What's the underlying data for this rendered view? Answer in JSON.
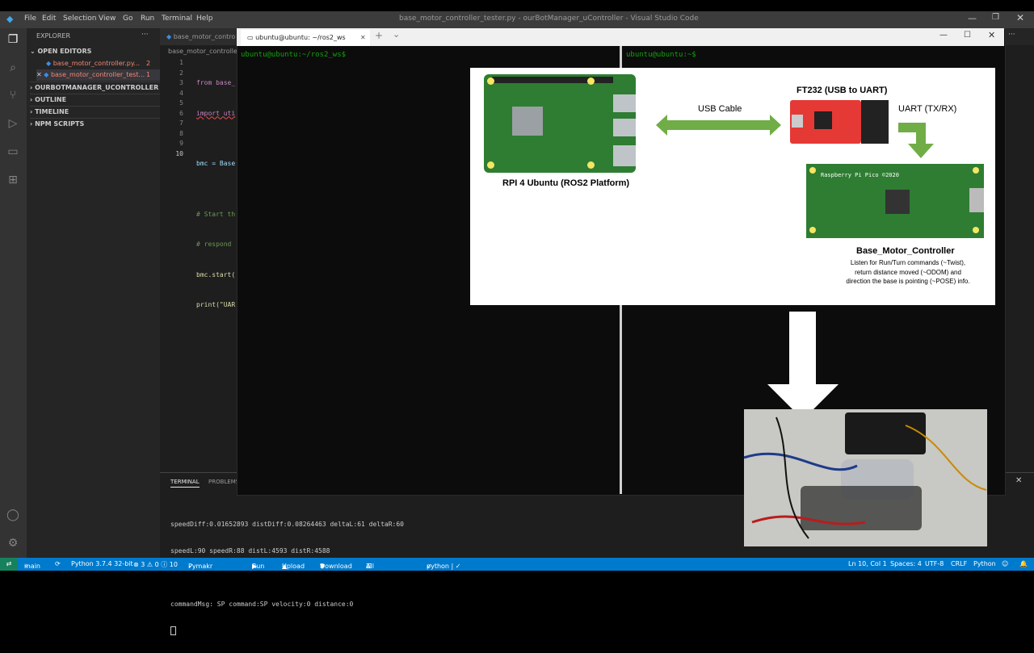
{
  "window": {
    "title": "base_motor_controller_tester.py - ourBotManager_uController - Visual Studio Code"
  },
  "menu": [
    "File",
    "Edit",
    "Selection",
    "View",
    "Go",
    "Run",
    "Terminal",
    "Help"
  ],
  "explorer": {
    "header": "EXPLORER",
    "open_editors": "OPEN EDITORS",
    "files": [
      {
        "name": "base_motor_controller.py...",
        "badge": "2"
      },
      {
        "name": "base_motor_controller_test...",
        "badge": "1"
      }
    ],
    "sections": [
      "OURBOTMANAGER_UCONTROLLER",
      "OUTLINE",
      "TIMELINE",
      "NPM SCRIPTS"
    ]
  },
  "editor": {
    "tab": "base_motor_contro",
    "breadcrumb": "base_motor_controller",
    "lines": [
      "from base_",
      "import uti",
      "",
      "bmc = Base",
      "",
      "# Start th",
      "# respond",
      "bmc.start(",
      "print(\"UAR",
      ""
    ],
    "line_numbers": [
      "1",
      "2",
      "3",
      "4",
      "5",
      "6",
      "7",
      "8",
      "9",
      "10"
    ]
  },
  "terminal_window": {
    "tab_title": "ubuntu@ubuntu: ~/ros2_ws",
    "new_tab": "+",
    "dropdown": "⌄",
    "prompt_left": "ubuntu@ubuntu:~/ros2_ws$",
    "prompt_right": "ubuntu@ubuntu:~$"
  },
  "diagram": {
    "rpi_label": "RPI 4 Ubuntu (ROS2 Platform)",
    "usb_label": "USB Cable",
    "ft232_label": "FT232 (USB to UART)",
    "uart_label": "UART (TX/RX)",
    "pico_board_text": "Raspberry Pi Pico ©2020",
    "bmc_title": "Base_Motor_Controller",
    "bmc_desc": [
      "Listen for Run/Turn commands (~Twist),",
      "return distance moved (~ODOM) and",
      "direction the base is pointing (~POSE) info."
    ]
  },
  "panel": {
    "tabs": [
      "TERMINAL",
      "PROBLEMS"
    ],
    "lines": [
      "speedDiff:0.01652893 distDiff:0.08264463 deltaL:61 deltaR:60",
      "speedL:90 speedR:88 distL:4593 distR:4588",
      "",
      "commandMsg: SP command:SP velocity:0 distance:0"
    ]
  },
  "statusbar": {
    "branch": "main",
    "python": "Python 3.7.4 32-bit",
    "problems": "⊗ 3 ⚠ 0 ⓘ 10",
    "pymakr": "Pymakr Console",
    "run": "Run",
    "upload": "Upload",
    "download": "Download",
    "all_commands": "All commands",
    "python_file": "python | ✓ base_motor_controller_tester.py",
    "position": "Ln 10, Col 1",
    "spaces": "Spaces: 4",
    "encoding": "UTF-8",
    "eol": "CRLF",
    "language": "Python"
  },
  "colors": {
    "accent": "#007acc",
    "terminal_green": "#13a10e",
    "arrow_green": "#70ad47"
  }
}
